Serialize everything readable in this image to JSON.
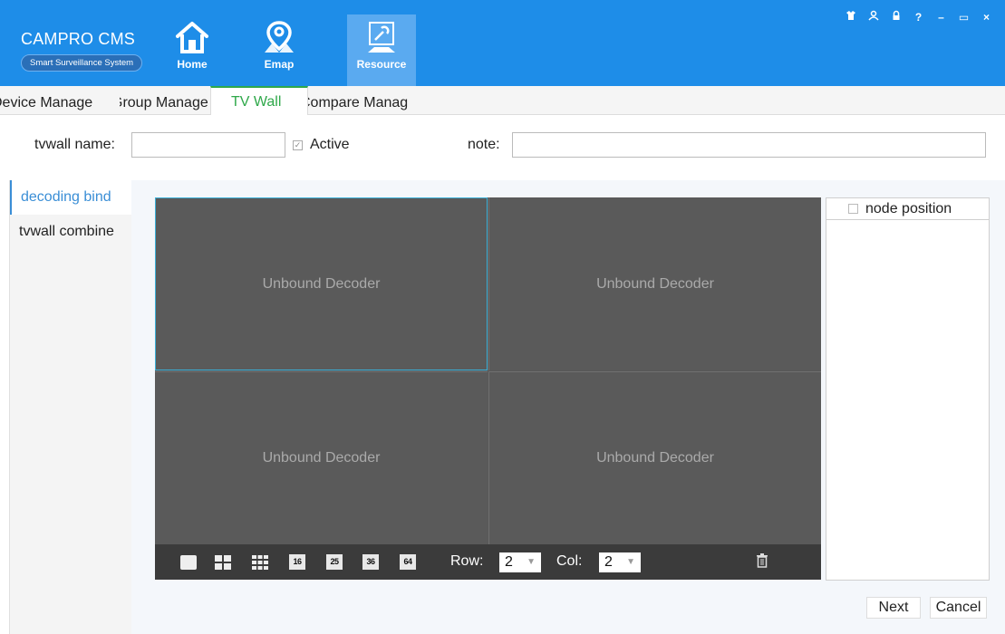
{
  "brand": {
    "title": "CAMPRO CMS",
    "subtitle": "Smart Surveillance System"
  },
  "nav": [
    {
      "label": "Home",
      "icon": "home-icon"
    },
    {
      "label": "Emap",
      "icon": "map-pin-icon"
    },
    {
      "label": "Resource",
      "icon": "wrench-icon",
      "active": true
    }
  ],
  "window_controls": [
    "shirt-icon",
    "user-icon",
    "lock-icon",
    "help-icon",
    "minimize-icon",
    "maximize-icon",
    "close-icon"
  ],
  "window_control_glyphs": {
    "help": "?",
    "minimize": "–",
    "maximize": "▭",
    "close": "×"
  },
  "tabs": [
    {
      "label": "Device Manage"
    },
    {
      "label": "Group Manage"
    },
    {
      "label": "TV Wall",
      "active": true
    },
    {
      "label": "Compare Manage"
    }
  ],
  "form": {
    "name_label": "tvwall name:",
    "name_value": "",
    "active_label": "Active",
    "active_checked": true,
    "note_label": "note:",
    "note_value": ""
  },
  "left_menu": [
    {
      "label": "decoding bind",
      "active": true
    },
    {
      "label": "tvwall combine"
    }
  ],
  "grid": {
    "cells": [
      "Unbound Decoder",
      "Unbound Decoder",
      "Unbound Decoder",
      "Unbound Decoder"
    ],
    "selected_cell": 0
  },
  "toolbar": {
    "layouts": [
      "1",
      "4",
      "9",
      "16",
      "25",
      "36",
      "64"
    ],
    "row_label": "Row:",
    "row_value": "2",
    "col_label": "Col:",
    "col_value": "2"
  },
  "right_panel": {
    "header": "node position",
    "checked": false
  },
  "buttons": {
    "next": "Next",
    "cancel": "Cancel"
  },
  "colors": {
    "header_blue": "#1e8de8",
    "active_tab_green": "#2fa84a",
    "link_blue": "#3a8ed6",
    "grid_bg": "#5a5a5a"
  }
}
